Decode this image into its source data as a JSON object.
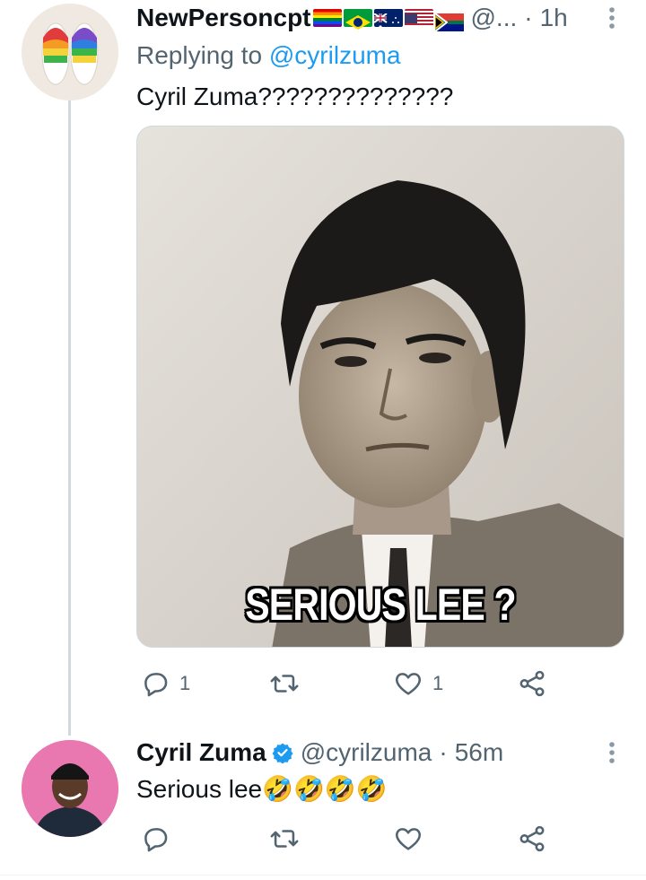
{
  "tweets": [
    {
      "display_name": "NewPersoncpt",
      "flags": [
        "rainbow-flag",
        "brazil-flag",
        "australia-flag",
        "usa-flag",
        "south-africa-flag"
      ],
      "handle": "@...",
      "time": "1h",
      "replying_prefix": "Replying to ",
      "replying_to": "@cyrilzuma",
      "text": "Cyril Zuma??????????????",
      "media": {
        "icon": "meme-photo",
        "caption": "SERIOUS LEE ?"
      },
      "replies": "1",
      "retweets": "",
      "likes": "1"
    },
    {
      "display_name": "Cyril Zuma",
      "verified": true,
      "handle": "@cyrilzuma",
      "time": "56m",
      "text": "Serious lee🤣🤣🤣🤣",
      "replies": "",
      "retweets": "",
      "likes": ""
    }
  ],
  "separator": "·",
  "colors": {
    "accent": "#1d9bf0",
    "muted": "#536471",
    "line": "#cfd9de"
  }
}
